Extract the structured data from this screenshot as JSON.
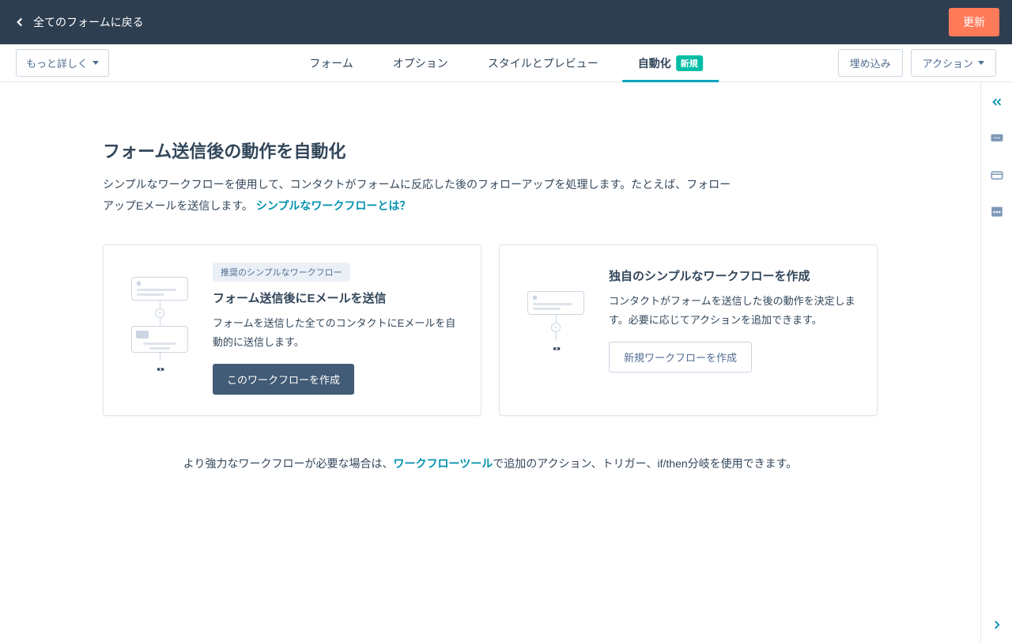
{
  "header": {
    "back_label": "全てのフォームに戻る",
    "update_label": "更新"
  },
  "toolbar": {
    "more_label": "もっと詳しく",
    "tabs": [
      {
        "label": "フォーム"
      },
      {
        "label": "オプション"
      },
      {
        "label": "スタイルとプレビュー"
      },
      {
        "label": "自動化",
        "badge": "新規",
        "active": true
      }
    ],
    "embed_label": "埋め込み",
    "actions_label": "アクション"
  },
  "main": {
    "title": "フォーム送信後の動作を自動化",
    "desc_prefix": "シンプルなワークフローを使用して、コンタクトがフォームに反応した後のフォローアップを処理します。たとえば、フォローアップEメールを送信します。 ",
    "desc_link": "シンプルなワークフローとは？"
  },
  "card1": {
    "badge": "推奨のシンプルなワークフロー",
    "title": "フォーム送信後にEメールを送信",
    "desc": "フォームを送信した全てのコンタクトにEメールを自動的に送信します。",
    "button": "このワークフローを作成"
  },
  "card2": {
    "title": "独自のシンプルなワークフローを作成",
    "desc": "コンタクトがフォームを送信した後の動作を決定します。必要に応じてアクションを追加できます。",
    "button": "新規ワークフローを作成"
  },
  "footer": {
    "prefix": "より強力なワークフローが必要な場合は、",
    "link": "ワークフローツール",
    "suffix": "で追加のアクション、トリガー、if/then分岐を使用できます。"
  }
}
